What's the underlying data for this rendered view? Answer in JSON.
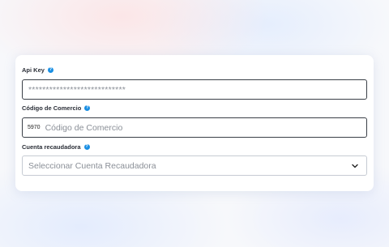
{
  "api_key": {
    "label": "Api Key",
    "help": "?",
    "placeholder": "****************************"
  },
  "codigo_comercio": {
    "label": "Código de Comercio",
    "help": "?",
    "prefix": "5970",
    "placeholder": "Código de Comercio"
  },
  "cuenta_recaudadora": {
    "label": "Cuenta recaudadora",
    "help": "?",
    "selected": "Seleccionar Cuenta Recaudadora",
    "icon": "chevron-down-icon"
  },
  "colors": {
    "help_icon": "#1a8fe3",
    "field_border": "#3a3f47",
    "select_border": "#c6cbd3"
  }
}
